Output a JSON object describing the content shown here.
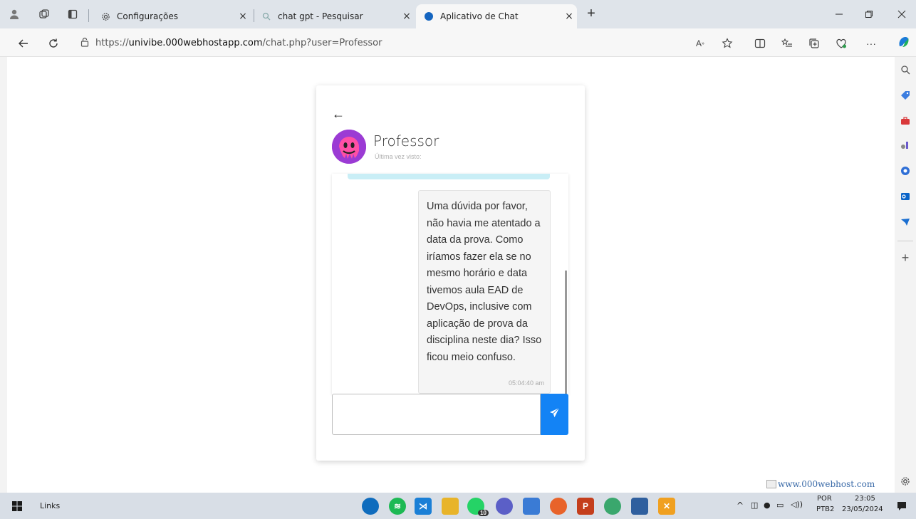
{
  "browser": {
    "tabs": [
      {
        "label": "Configurações",
        "icon": "gear-icon",
        "active": false
      },
      {
        "label": "chat gpt - Pesquisar",
        "icon": "search-icon",
        "active": false
      },
      {
        "label": "Aplicativo de Chat",
        "icon": "blue-dot-icon",
        "active": true
      }
    ],
    "close_glyph": "×",
    "new_tab_glyph": "+",
    "url_scheme": "https://",
    "url_host": "univibe.000webhostapp.com",
    "url_path": "/chat.php?user=Professor",
    "more_glyph": "···"
  },
  "chat": {
    "back_glyph": "←",
    "username": "Professor",
    "last_seen": "Última vez visto:",
    "message": {
      "text": "Uma dúvida por favor, não havia me atentado a data da prova. Como iríamos fazer ela se no mesmo horário e data tivemos aula EAD de DevOps, inclusive com aplicação de prova da disciplina neste dia? Isso ficou meio confuso.",
      "time": "05:04:40 am"
    },
    "input_placeholder": ""
  },
  "host_badge": "www.000webhost.com",
  "taskbar": {
    "links_label": "Links",
    "whatsapp_badge": "10",
    "lang_top": "POR",
    "lang_bottom": "PTB2",
    "time": "23:05",
    "date": "23/05/2024"
  },
  "colors": {
    "accent": "#1383f5",
    "avatar_bg": "#9b3bd4",
    "prev_bubble": "#c9eef6"
  }
}
